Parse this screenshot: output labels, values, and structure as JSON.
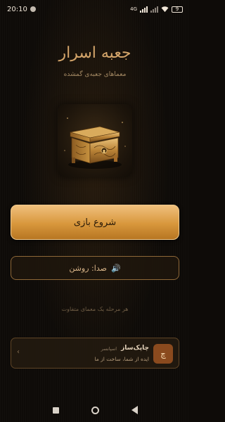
{
  "status_bar": {
    "time": "20:10",
    "network": "4G",
    "battery": "9"
  },
  "header": {
    "title": "جعبه اسرار",
    "subtitle": "معماهای جعبه‌ی گمشده"
  },
  "main": {
    "start_button": "شروع بازی",
    "sound_label": "صدا:  روشن"
  },
  "hint_text": "هر مرحله یک معمای متفاوت",
  "sponsor": {
    "tag": "اسپانسر",
    "name": "چاپک‌ساز",
    "description": "ایده از شما، ساخت از ما",
    "logo_letter": "چ"
  },
  "colors": {
    "accent": "#d8973c",
    "title": "#d4a56a",
    "background": "#0e0b08"
  },
  "icons": [
    "speaker-icon",
    "chevron-left-icon",
    "chest-image"
  ]
}
